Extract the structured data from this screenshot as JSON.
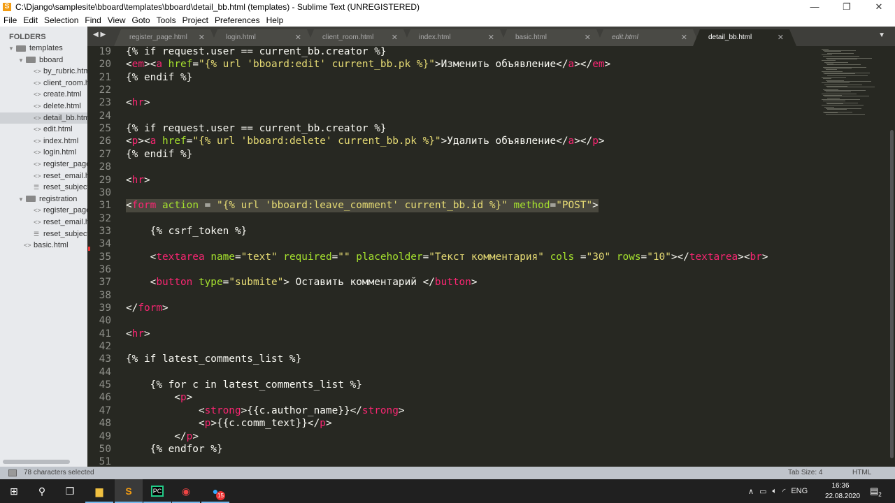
{
  "window": {
    "title": "C:\\Django\\samplesite\\bboard\\templates\\bboard\\detail_bb.html (templates) - Sublime Text (UNREGISTERED)",
    "minimize": "—",
    "maximize": "❐",
    "close": "✕"
  },
  "menu": [
    "File",
    "Edit",
    "Selection",
    "Find",
    "View",
    "Goto",
    "Tools",
    "Project",
    "Preferences",
    "Help"
  ],
  "sidebar": {
    "header": "FOLDERS",
    "items": [
      {
        "label": "templates",
        "type": "folder",
        "depth": 0
      },
      {
        "label": "bboard",
        "type": "folder",
        "depth": 1
      },
      {
        "label": "by_rubric.html",
        "type": "html",
        "depth": 2
      },
      {
        "label": "client_room.html",
        "type": "html",
        "depth": 2
      },
      {
        "label": "create.html",
        "type": "html",
        "depth": 2
      },
      {
        "label": "delete.html",
        "type": "html",
        "depth": 2
      },
      {
        "label": "detail_bb.html",
        "type": "html",
        "depth": 2,
        "selected": true
      },
      {
        "label": "edit.html",
        "type": "html",
        "depth": 2
      },
      {
        "label": "index.html",
        "type": "html",
        "depth": 2
      },
      {
        "label": "login.html",
        "type": "html",
        "depth": 2
      },
      {
        "label": "register_page.html",
        "type": "html",
        "depth": 2
      },
      {
        "label": "reset_email.html",
        "type": "html",
        "depth": 2
      },
      {
        "label": "reset_subject.txt",
        "type": "txt",
        "depth": 2
      },
      {
        "label": "registration",
        "type": "folder",
        "depth": 1
      },
      {
        "label": "register_page.html",
        "type": "html",
        "depth": 2
      },
      {
        "label": "reset_email.html",
        "type": "html",
        "depth": 2
      },
      {
        "label": "reset_subject.txt",
        "type": "txt",
        "depth": 2
      },
      {
        "label": "basic.html",
        "type": "html",
        "depth": 1
      }
    ]
  },
  "tabs": [
    {
      "label": "register_page.html"
    },
    {
      "label": "login.html"
    },
    {
      "label": "client_room.html"
    },
    {
      "label": "index.html"
    },
    {
      "label": "basic.html"
    },
    {
      "label": "edit.html",
      "italic": true
    },
    {
      "label": "detail_bb.html",
      "active": true
    }
  ],
  "editor": {
    "first_line": 19,
    "highlight_line": 31,
    "lines": [
      [
        [
          "{% if request.user == current_bb.creator %}",
          "p"
        ]
      ],
      [
        [
          "<",
          "p"
        ],
        [
          "em",
          "t"
        ],
        [
          "><",
          "p"
        ],
        [
          "a",
          "t"
        ],
        [
          " ",
          "p"
        ],
        [
          "href",
          "a"
        ],
        [
          "=",
          "p"
        ],
        [
          "\"{% url 'bboard:edit' current_bb.pk %}\"",
          "s"
        ],
        [
          ">Изменить объявление</",
          "p"
        ],
        [
          "a",
          "t"
        ],
        [
          "></",
          "p"
        ],
        [
          "em",
          "t"
        ],
        [
          ">",
          "p"
        ]
      ],
      [
        [
          "{% endif %}",
          "p"
        ]
      ],
      [],
      [
        [
          "<",
          "p"
        ],
        [
          "hr",
          "t"
        ],
        [
          ">",
          "p"
        ]
      ],
      [],
      [
        [
          "{% if request.user == current_bb.creator %}",
          "p"
        ]
      ],
      [
        [
          "<",
          "p"
        ],
        [
          "p",
          "t"
        ],
        [
          "><",
          "p"
        ],
        [
          "a",
          "t"
        ],
        [
          " ",
          "p"
        ],
        [
          "href",
          "a"
        ],
        [
          "=",
          "p"
        ],
        [
          "\"{% url 'bboard:delete' current_bb.pk %}\"",
          "s"
        ],
        [
          ">Удалить объявление</",
          "p"
        ],
        [
          "a",
          "t"
        ],
        [
          "></",
          "p"
        ],
        [
          "p",
          "t"
        ],
        [
          ">",
          "p"
        ]
      ],
      [
        [
          "{% endif %}",
          "p"
        ]
      ],
      [],
      [
        [
          "<",
          "p"
        ],
        [
          "hr",
          "t"
        ],
        [
          ">",
          "p"
        ]
      ],
      [],
      [
        [
          "<",
          "p"
        ],
        [
          "form",
          "t"
        ],
        [
          " ",
          "p"
        ],
        [
          "action",
          "a"
        ],
        [
          " = ",
          "p"
        ],
        [
          "\"{% url 'bboard:leave_comment' current_bb.id %}\"",
          "s"
        ],
        [
          " ",
          "p"
        ],
        [
          "method",
          "a"
        ],
        [
          "=",
          "p"
        ],
        [
          "\"POST\"",
          "s"
        ],
        [
          ">",
          "p"
        ]
      ],
      [],
      [
        [
          "    {% csrf_token %}",
          "p"
        ]
      ],
      [],
      [
        [
          "    <",
          "p"
        ],
        [
          "textarea",
          "t"
        ],
        [
          " ",
          "p"
        ],
        [
          "name",
          "a"
        ],
        [
          "=",
          "p"
        ],
        [
          "\"text\"",
          "s"
        ],
        [
          " ",
          "p"
        ],
        [
          "required",
          "a"
        ],
        [
          "=",
          "p"
        ],
        [
          "\"\"",
          "s"
        ],
        [
          " ",
          "p"
        ],
        [
          "placeholder",
          "a"
        ],
        [
          "=",
          "p"
        ],
        [
          "\"Текст комментария\"",
          "s"
        ],
        [
          " ",
          "p"
        ],
        [
          "cols",
          "a"
        ],
        [
          " =",
          "p"
        ],
        [
          "\"30\"",
          "s"
        ],
        [
          " ",
          "p"
        ],
        [
          "rows",
          "a"
        ],
        [
          "=",
          "p"
        ],
        [
          "\"10\"",
          "s"
        ],
        [
          "></",
          "p"
        ],
        [
          "textarea",
          "t"
        ],
        [
          "><",
          "p"
        ],
        [
          "br",
          "t"
        ],
        [
          ">",
          "p"
        ]
      ],
      [],
      [
        [
          "    <",
          "p"
        ],
        [
          "button",
          "t"
        ],
        [
          " ",
          "p"
        ],
        [
          "type",
          "a"
        ],
        [
          "=",
          "p"
        ],
        [
          "\"submite\"",
          "s"
        ],
        [
          "> Оставить комментарий </",
          "p"
        ],
        [
          "button",
          "t"
        ],
        [
          ">",
          "p"
        ]
      ],
      [],
      [
        [
          "</",
          "p"
        ],
        [
          "form",
          "t"
        ],
        [
          ">",
          "p"
        ]
      ],
      [],
      [
        [
          "<",
          "p"
        ],
        [
          "hr",
          "t"
        ],
        [
          ">",
          "p"
        ]
      ],
      [],
      [
        [
          "{% if latest_comments_list %}",
          "p"
        ]
      ],
      [],
      [
        [
          "    {% for c in latest_comments_list %}",
          "p"
        ]
      ],
      [
        [
          "        <",
          "p"
        ],
        [
          "p",
          "t"
        ],
        [
          ">",
          "p"
        ]
      ],
      [
        [
          "            <",
          "p"
        ],
        [
          "strong",
          "t"
        ],
        [
          ">{{c.author_name}}</",
          "p"
        ],
        [
          "strong",
          "t"
        ],
        [
          ">",
          "p"
        ]
      ],
      [
        [
          "            <",
          "p"
        ],
        [
          "p",
          "t"
        ],
        [
          ">{{c.comm_text}}</",
          "p"
        ],
        [
          "p",
          "t"
        ],
        [
          ">",
          "p"
        ]
      ],
      [
        [
          "        </",
          "p"
        ],
        [
          "p",
          "t"
        ],
        [
          ">",
          "p"
        ]
      ],
      [
        [
          "    {% endfor %}",
          "p"
        ]
      ],
      []
    ]
  },
  "status": {
    "selection": "78 characters selected",
    "tab_size": "Tab Size: 4",
    "syntax": "HTML"
  },
  "taskbar": {
    "apps": [
      "start",
      "search",
      "task-view",
      "file-explorer",
      "sublime-text",
      "pycharm",
      "chrome",
      "telegram"
    ],
    "telegram_badge": "15",
    "tray": {
      "language": "ENG",
      "time": "16:36",
      "date": "22.08.2020",
      "notifications": "2"
    }
  }
}
